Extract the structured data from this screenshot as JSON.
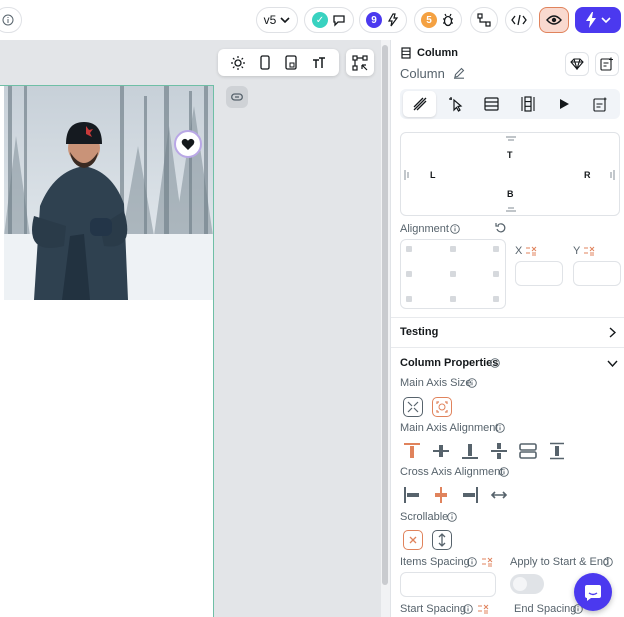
{
  "topbar": {
    "version_label": "v5",
    "comments_badge": "9",
    "issues_badge": "5"
  },
  "panel": {
    "widget_type": "Column",
    "widget_name": "Column",
    "padding": {
      "top": "T",
      "bottom": "B",
      "left": "L",
      "right": "R"
    },
    "alignment_label": "Alignment",
    "x_label": "X",
    "y_label": "Y",
    "testing_label": "Testing",
    "column_properties_label": "Column Properties",
    "main_axis_size_label": "Main Axis Size",
    "main_axis_alignment_label": "Main Axis Alignment",
    "cross_axis_alignment_label": "Cross Axis Alignment",
    "scrollable_label": "Scrollable",
    "items_spacing_label": "Items Spacing",
    "apply_start_end_label": "Apply to Start & End",
    "start_spacing_label": "Start Spacing",
    "end_spacing_label": "End Spacing"
  },
  "colors": {
    "accent": "#4b39ef",
    "selected": "#e0835c",
    "preview_active": "#f9d9cf",
    "success": "#39d2c0",
    "warning": "#f4a142"
  },
  "icons": {
    "left_info": "info-icon",
    "theme": "sun-icon",
    "device_phone": "phone-icon",
    "device_tablet": "tablet-icon",
    "text_size": "text-size-icon",
    "heart": "heart-icon",
    "chat": "chat-bubble-icon"
  }
}
